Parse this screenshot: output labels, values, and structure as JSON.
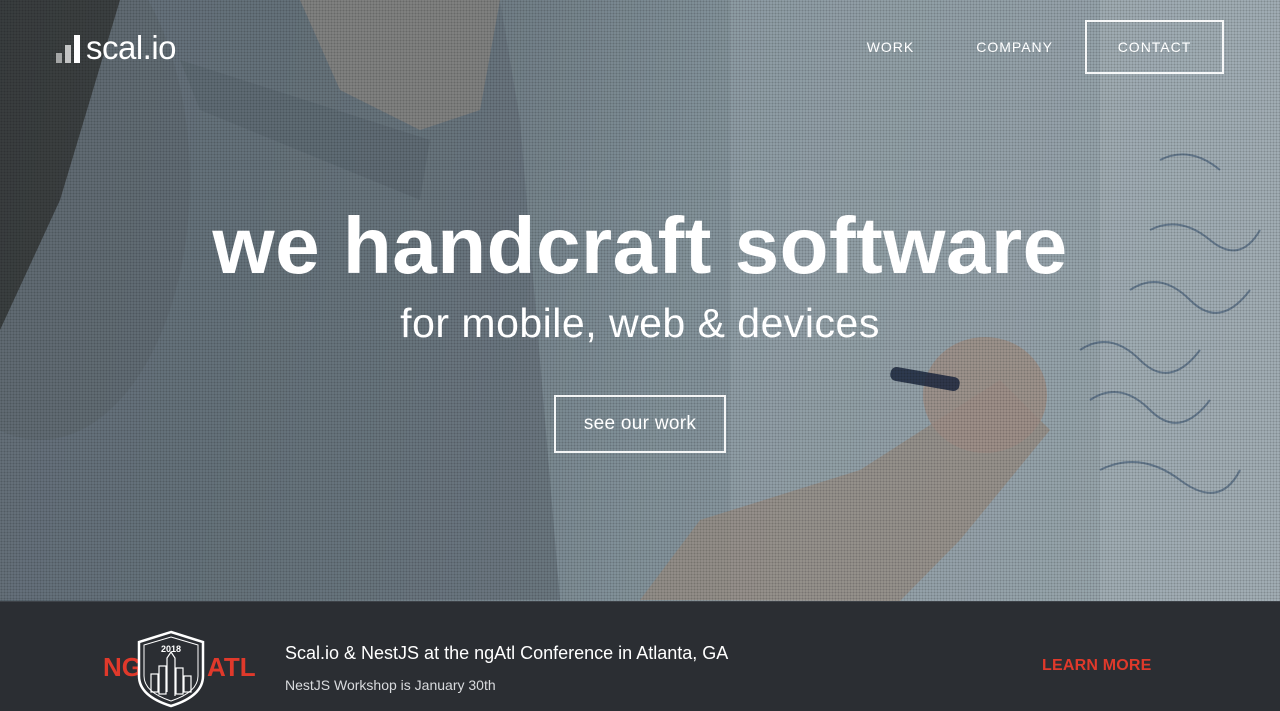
{
  "header": {
    "logo_text": "scal.io",
    "nav": {
      "work": "WORK",
      "company": "COMPANY",
      "contact": "CONTACT"
    }
  },
  "hero": {
    "headline": "we handcraft software",
    "subhead": "for mobile, web & devices",
    "cta_label": "see our work",
    "background": "photo of a person writing on a whiteboard"
  },
  "banner": {
    "badge": {
      "left_text": "NG",
      "right_text": "ATL",
      "year": "2018"
    },
    "title": "Scal.io & NestJS at the ngAtl Conference in Atlanta, GA",
    "subtitle": "NestJS Workshop is January 30th",
    "link_label": "LEARN MORE"
  },
  "colors": {
    "accent_red": "#e0392b",
    "banner_bg": "#2b2e33",
    "text_white": "#ffffff"
  }
}
